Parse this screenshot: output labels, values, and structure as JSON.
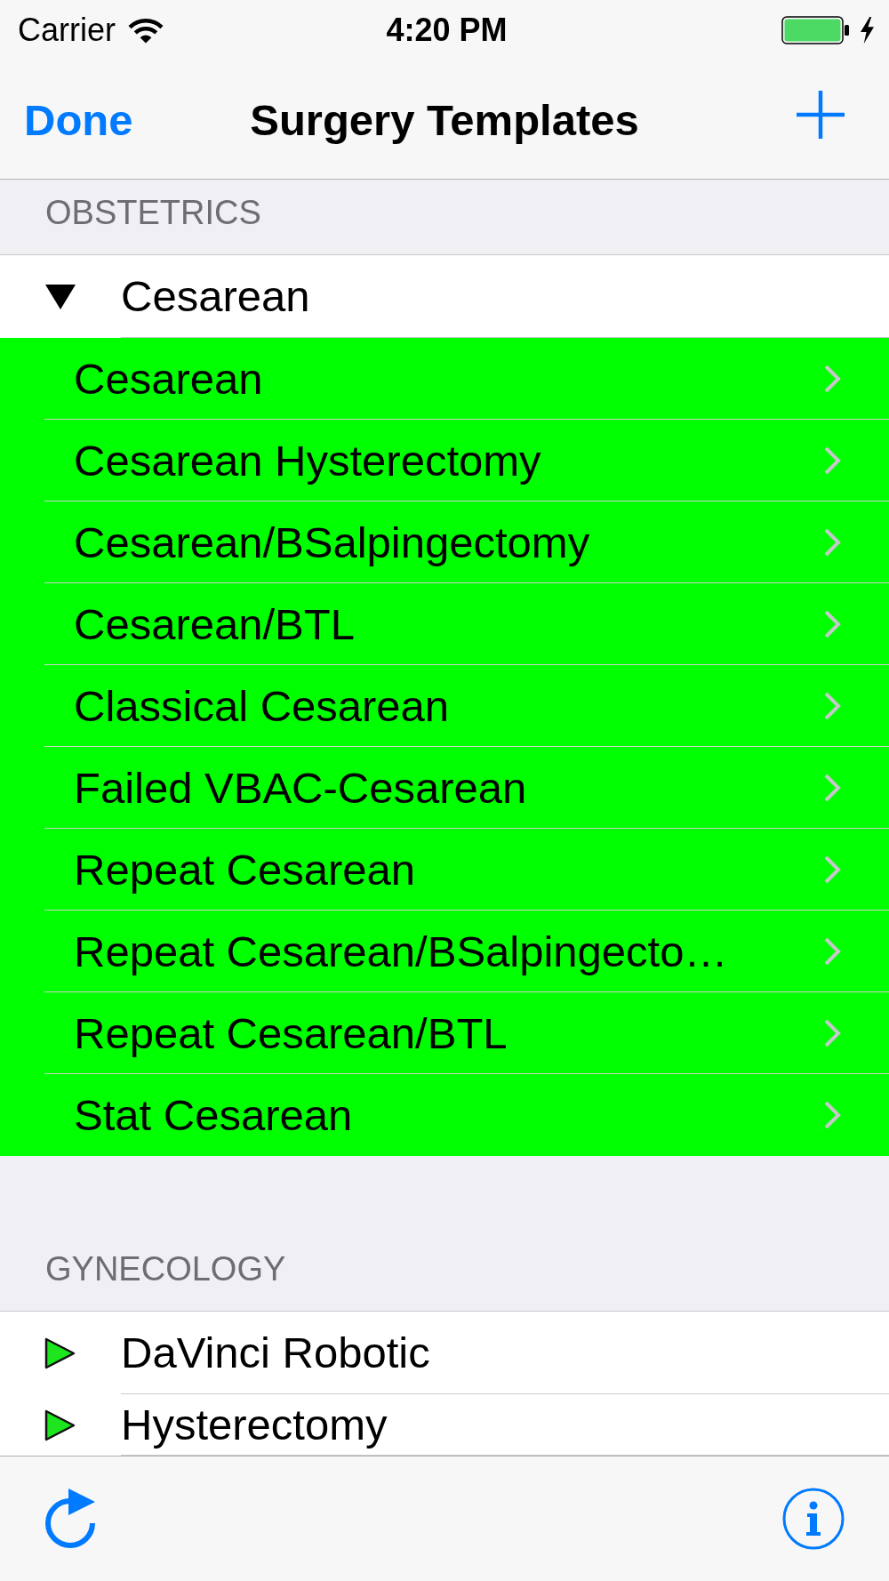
{
  "status_bar": {
    "carrier": "Carrier",
    "time": "4:20 PM",
    "charging": true
  },
  "nav_bar": {
    "left_button": "Done",
    "title": "Surgery Templates"
  },
  "sections": [
    {
      "header": "OBSTETRICS",
      "groups": [
        {
          "label": "Cesarean",
          "expanded": true,
          "children": [
            {
              "label": "Cesarean"
            },
            {
              "label": "Cesarean Hysterectomy"
            },
            {
              "label": "Cesarean/BSalpingectomy"
            },
            {
              "label": "Cesarean/BTL"
            },
            {
              "label": "Classical Cesarean"
            },
            {
              "label": "Failed VBAC-Cesarean"
            },
            {
              "label": "Repeat Cesarean"
            },
            {
              "label": "Repeat Cesarean/BSalpingecto…"
            },
            {
              "label": "Repeat Cesarean/BTL"
            },
            {
              "label": "Stat Cesarean"
            }
          ]
        }
      ]
    },
    {
      "header": "GYNECOLOGY",
      "groups": [
        {
          "label": "DaVinci Robotic",
          "expanded": false
        },
        {
          "label": "Hysterectomy",
          "expanded": false
        }
      ]
    }
  ]
}
